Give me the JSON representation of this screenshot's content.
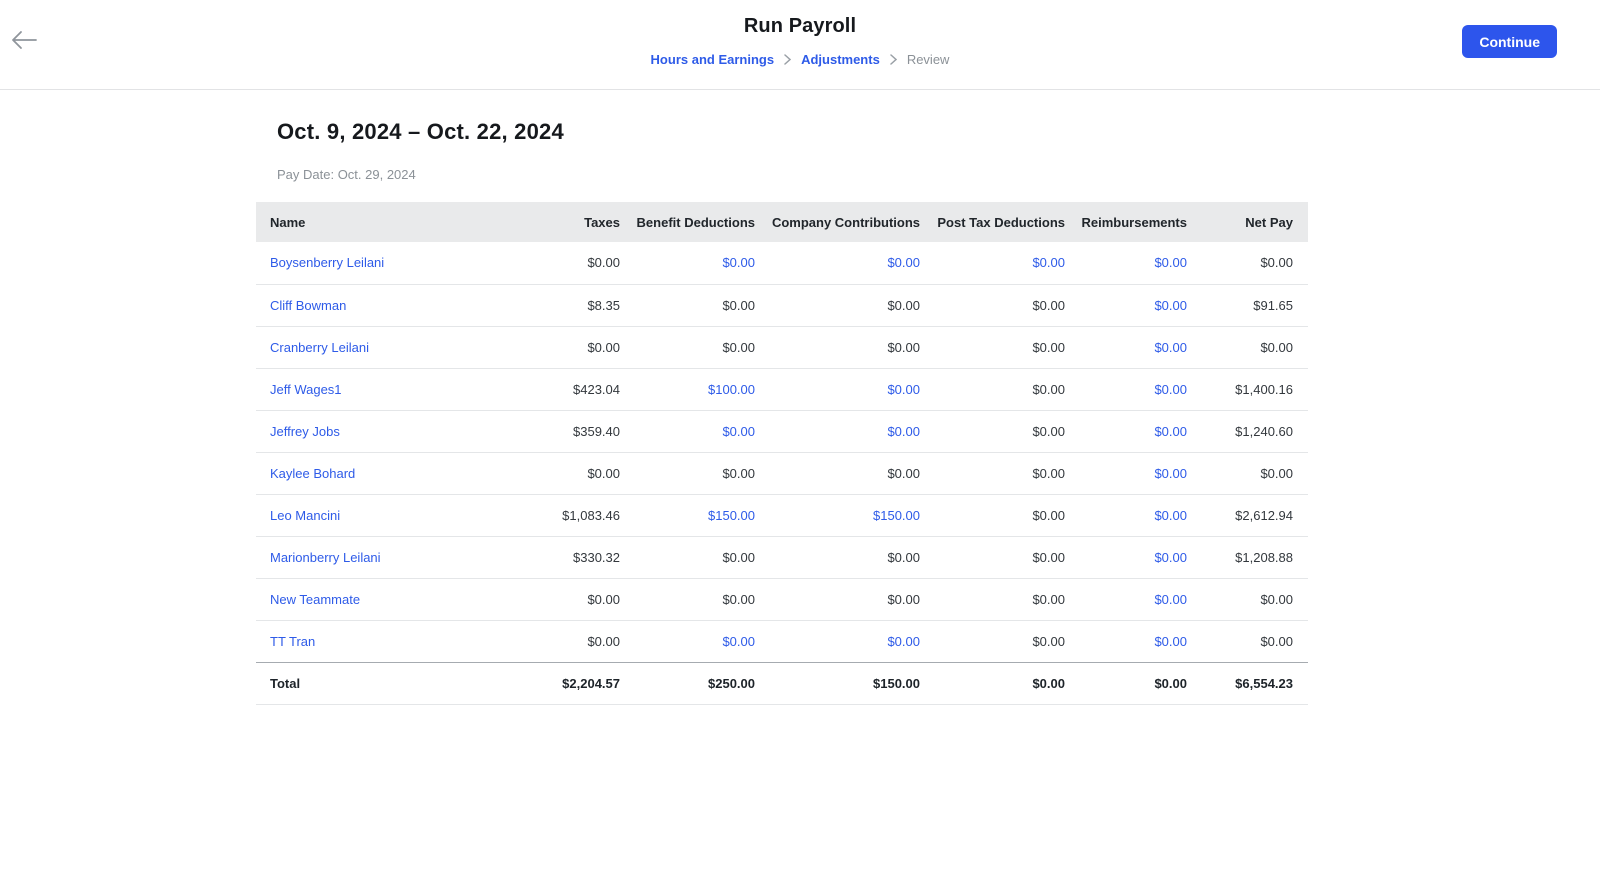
{
  "colors": {
    "accent_blue": "#2d55ec",
    "link_blue": "#2e5be8",
    "table_header_bg": "#e9eaeb",
    "text_dark": "#16191d",
    "text_gray": "#8b9197"
  },
  "header": {
    "title": "Run Payroll",
    "breadcrumbs": [
      {
        "label": "Hours and Earnings",
        "current": false
      },
      {
        "label": "Adjustments",
        "current": false
      },
      {
        "label": "Review",
        "current": true
      }
    ],
    "continue_label": "Continue"
  },
  "period": {
    "date_range": "Oct. 9, 2024 – Oct. 22, 2024",
    "pay_date_label": "Pay Date: Oct. 29, 2024"
  },
  "table": {
    "columns": [
      "Name",
      "Taxes",
      "Benefit Deductions",
      "Company Contributions",
      "Post Tax Deductions",
      "Reimbursements",
      "Net Pay"
    ],
    "rows": [
      {
        "name": "Boysenberry Leilani",
        "values": [
          "$0.00",
          "$0.00",
          "$0.00",
          "$0.00",
          "$0.00",
          "$0.00"
        ],
        "links": [
          false,
          true,
          true,
          true,
          true,
          false
        ]
      },
      {
        "name": "Cliff Bowman",
        "values": [
          "$8.35",
          "$0.00",
          "$0.00",
          "$0.00",
          "$0.00",
          "$91.65"
        ],
        "links": [
          false,
          false,
          false,
          false,
          true,
          false
        ]
      },
      {
        "name": "Cranberry Leilani",
        "values": [
          "$0.00",
          "$0.00",
          "$0.00",
          "$0.00",
          "$0.00",
          "$0.00"
        ],
        "links": [
          false,
          false,
          false,
          false,
          true,
          false
        ]
      },
      {
        "name": "Jeff Wages1",
        "values": [
          "$423.04",
          "$100.00",
          "$0.00",
          "$0.00",
          "$0.00",
          "$1,400.16"
        ],
        "links": [
          false,
          true,
          true,
          false,
          true,
          false
        ]
      },
      {
        "name": "Jeffrey Jobs",
        "values": [
          "$359.40",
          "$0.00",
          "$0.00",
          "$0.00",
          "$0.00",
          "$1,240.60"
        ],
        "links": [
          false,
          true,
          true,
          false,
          true,
          false
        ]
      },
      {
        "name": "Kaylee Bohard",
        "values": [
          "$0.00",
          "$0.00",
          "$0.00",
          "$0.00",
          "$0.00",
          "$0.00"
        ],
        "links": [
          false,
          false,
          false,
          false,
          true,
          false
        ]
      },
      {
        "name": "Leo Mancini",
        "values": [
          "$1,083.46",
          "$150.00",
          "$150.00",
          "$0.00",
          "$0.00",
          "$2,612.94"
        ],
        "links": [
          false,
          true,
          true,
          false,
          true,
          false
        ]
      },
      {
        "name": "Marionberry Leilani",
        "values": [
          "$330.32",
          "$0.00",
          "$0.00",
          "$0.00",
          "$0.00",
          "$1,208.88"
        ],
        "links": [
          false,
          false,
          false,
          false,
          true,
          false
        ]
      },
      {
        "name": "New Teammate",
        "values": [
          "$0.00",
          "$0.00",
          "$0.00",
          "$0.00",
          "$0.00",
          "$0.00"
        ],
        "links": [
          false,
          false,
          false,
          false,
          true,
          false
        ]
      },
      {
        "name": "TT Tran",
        "values": [
          "$0.00",
          "$0.00",
          "$0.00",
          "$0.00",
          "$0.00",
          "$0.00"
        ],
        "links": [
          false,
          true,
          true,
          false,
          true,
          false
        ]
      }
    ],
    "total": {
      "label": "Total",
      "values": [
        "$2,204.57",
        "$250.00",
        "$150.00",
        "$0.00",
        "$0.00",
        "$6,554.23"
      ]
    }
  }
}
